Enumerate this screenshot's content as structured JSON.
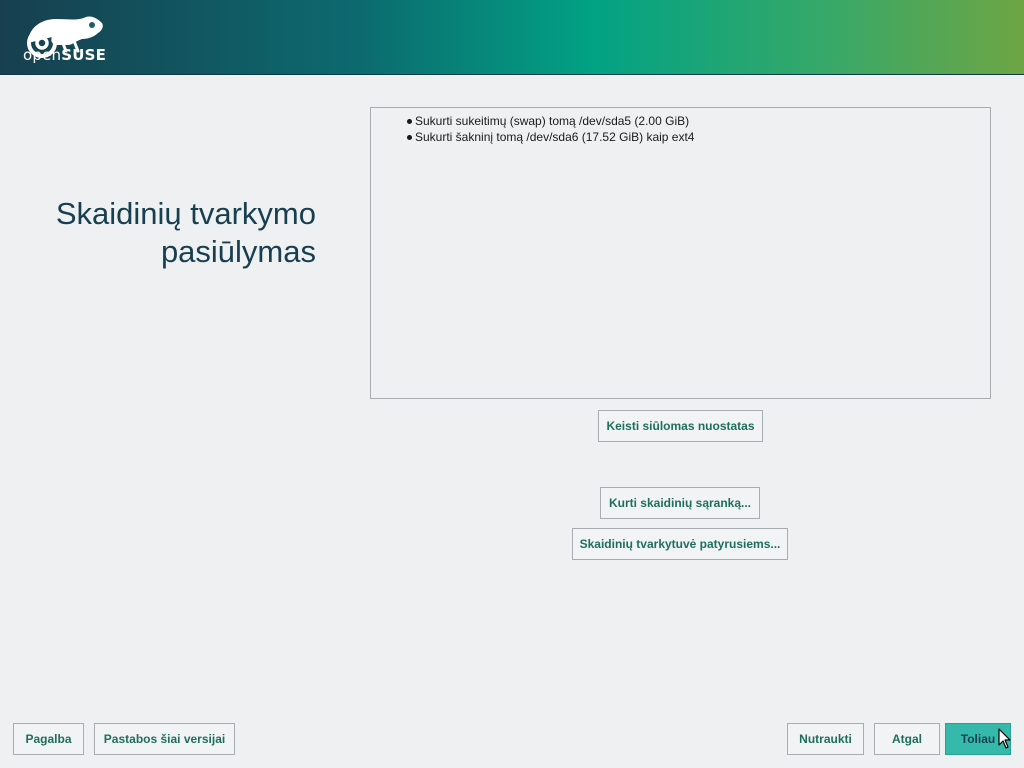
{
  "header": {
    "logo_text_light": "open",
    "logo_text_bold": "SUSE"
  },
  "title_line1": "Skaidinių tvarkymo",
  "title_line2": "pasiūlymas",
  "proposal_items": [
    "Sukurti sukeitimų (swap) tomą /dev/sda5 (2.00 GiB)",
    "Sukurti šakninį tomą /dev/sda6 (17.52 GiB) kaip ext4"
  ],
  "buttons": {
    "edit_proposal": "Keisti siūlomas nuostatas",
    "create_setup": "Kurti skaidinių sąranką...",
    "expert_partitioner": "Skaidinių tvarkytuvė patyrusiems...",
    "help": "Pagalba",
    "release_notes": "Pastabos šiai versijai",
    "abort": "Nutraukti",
    "back": "Atgal",
    "next": "Toliau"
  }
}
